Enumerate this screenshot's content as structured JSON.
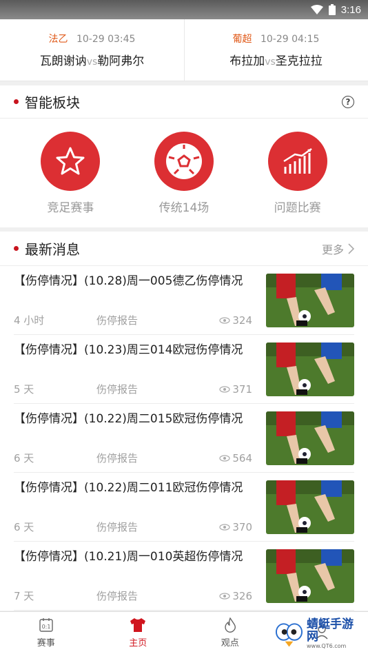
{
  "status_bar": {
    "time": "3:16",
    "icons": [
      "wifi-icon",
      "battery-icon"
    ]
  },
  "matches": [
    {
      "league": "法乙",
      "datetime": "10-29 03:45",
      "home": "瓦朗谢讷",
      "vs": "vs",
      "away": "勒阿弗尔"
    },
    {
      "league": "葡超",
      "datetime": "10-29 04:15",
      "home": "布拉加",
      "vs": "vs",
      "away": "圣克拉拉"
    }
  ],
  "smart": {
    "title": "智能板块",
    "tools": [
      {
        "label": "竞足赛事",
        "icon": "star-icon"
      },
      {
        "label": "传统14场",
        "icon": "soccer-ball-icon"
      },
      {
        "label": "问题比赛",
        "icon": "bar-chart-trend-icon"
      }
    ]
  },
  "news": {
    "title": "最新消息",
    "more": "更多",
    "items": [
      {
        "title": "【伤停情况】(10.28)周一005德乙伤停情况",
        "age": "4 小时",
        "category": "伤停报告",
        "views": "324"
      },
      {
        "title": "【伤停情况】(10.23)周三014欧冠伤停情况",
        "age": "5 天",
        "category": "伤停报告",
        "views": "371"
      },
      {
        "title": "【伤停情况】(10.22)周二015欧冠伤停情况",
        "age": "6 天",
        "category": "伤停报告",
        "views": "564"
      },
      {
        "title": "【伤停情况】(10.22)周二011欧冠伤停情况",
        "age": "6 天",
        "category": "伤停报告",
        "views": "370"
      },
      {
        "title": "【伤停情况】(10.21)周一010英超伤停情况",
        "age": "7 天",
        "category": "伤停报告",
        "views": "326"
      }
    ]
  },
  "tabbar": {
    "tabs": [
      {
        "label": "赛事",
        "icon": "scoreboard-icon"
      },
      {
        "label": "主页",
        "icon": "jersey-icon",
        "active": true
      },
      {
        "label": "观点",
        "icon": "flame-icon"
      }
    ]
  },
  "watermark": {
    "text": "蜻蜓手游网",
    "sub": "www.QT6.com"
  },
  "colors": {
    "accent": "#dc2f33",
    "league": "#e05a1a"
  }
}
